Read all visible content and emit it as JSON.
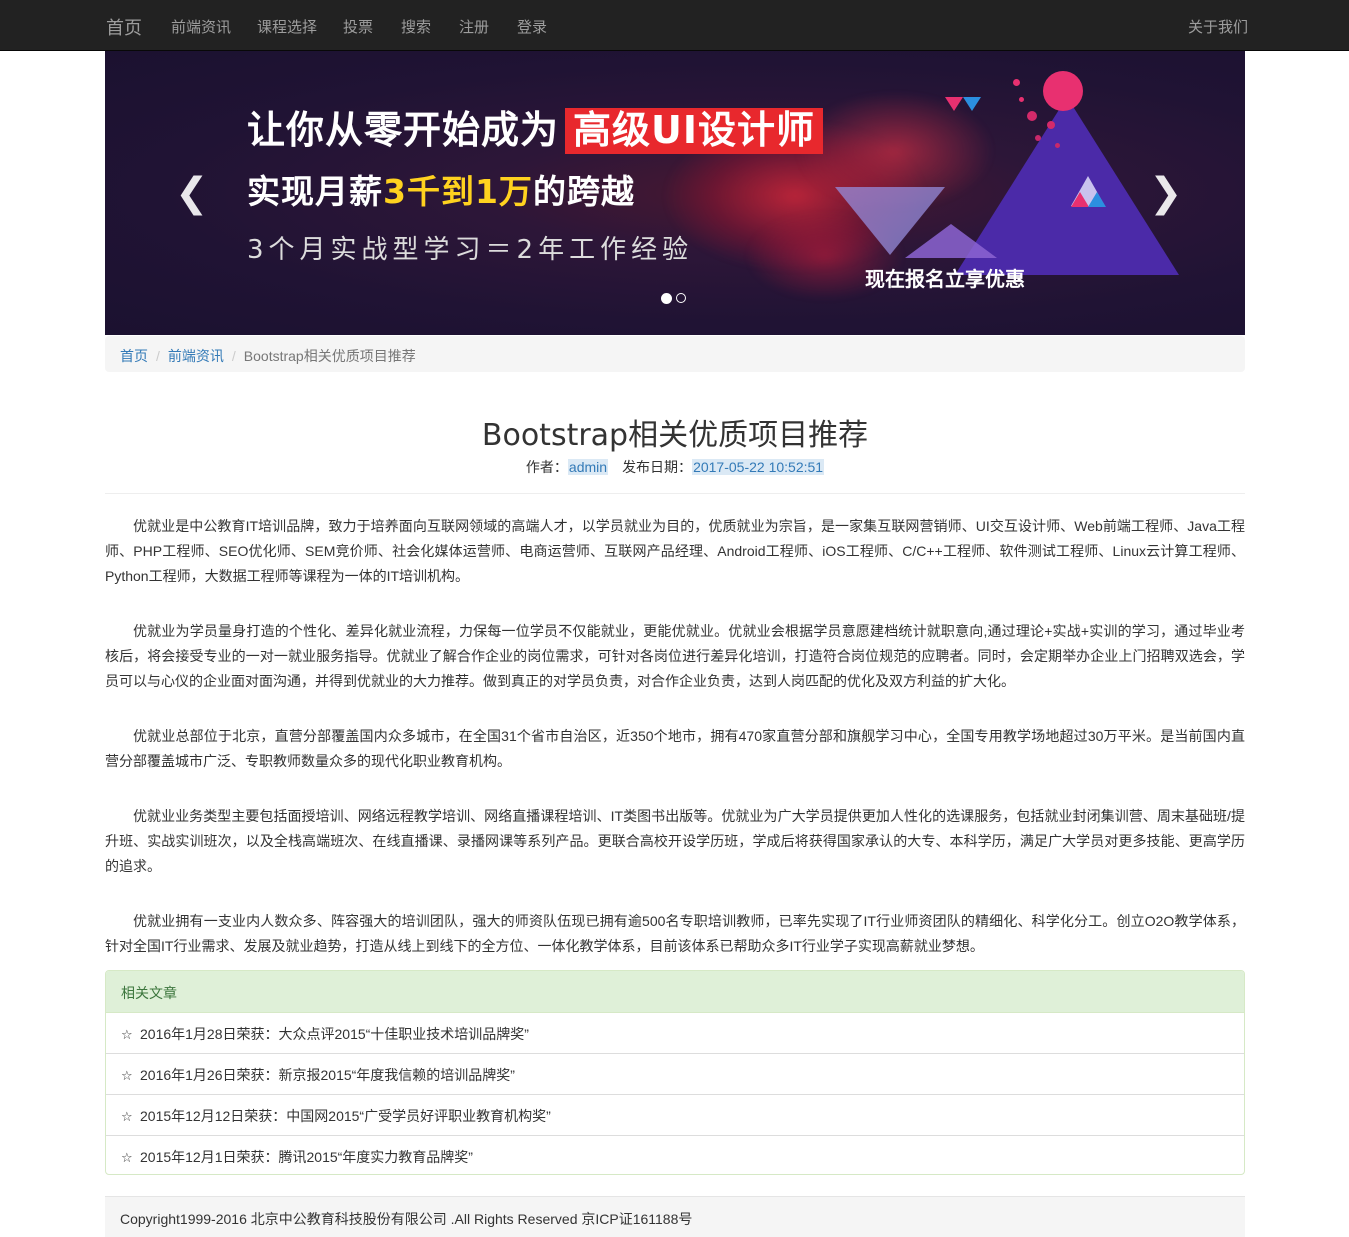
{
  "nav": {
    "brand": "首页",
    "items": [
      "前端资讯",
      "课程选择",
      "投票",
      "搜索",
      "注册",
      "登录"
    ],
    "right": "关于我们"
  },
  "banner": {
    "line1": "让你从零开始成为",
    "line1_highlight": "高级UI设计师",
    "line2_a": "实现月薪",
    "line2_highlight": "3千到1万",
    "line2_b": "的跨越",
    "line3": "3个月实战型学习＝2年工作经验",
    "cta": "现在报名立享优惠",
    "prev_icon": "chevron-left-icon",
    "next_icon": "chevron-right-icon",
    "prev_glyph": "❮",
    "next_glyph": "❯",
    "active_slide": 1,
    "slide_count": 2
  },
  "breadcrumb": {
    "home": "首页",
    "section": "前端资讯",
    "current": "Bootstrap相关优质项目推荐"
  },
  "article": {
    "title": "Bootstrap相关优质项目推荐",
    "author_label": "作者：",
    "author": "admin",
    "date_label": "发布日期：",
    "date": "2017-05-22 10:52:51",
    "paragraphs": [
      "优就业是中公教育IT培训品牌，致力于培养面向互联网领域的高端人才，以学员就业为目的，优质就业为宗旨，是一家集互联网营销师、UI交互设计师、Web前端工程师、Java工程师、PHP工程师、SEO优化师、SEM竞价师、社会化媒体运营师、电商运营师、互联网产品经理、Android工程师、iOS工程师、C/C++工程师、软件测试工程师、Linux云计算工程师、Python工程师，大数据工程师等课程为一体的IT培训机构。",
      "优就业为学员量身打造的个性化、差异化就业流程，力保每一位学员不仅能就业，更能优就业。优就业会根据学员意愿建档统计就职意向,通过理论+实战+实训的学习，通过毕业考核后，将会接受专业的一对一就业服务指导。优就业了解合作企业的岗位需求，可针对各岗位进行差异化培训，打造符合岗位规范的应聘者。同时，会定期举办企业上门招聘双选会，学员可以与心仪的企业面对面沟通，并得到优就业的大力推荐。做到真正的对学员负责，对合作企业负责，达到人岗匹配的优化及双方利益的扩大化。",
      "优就业总部位于北京，直营分部覆盖国内众多城市，在全国31个省市自治区，近350个地市，拥有470家直营分部和旗舰学习中心，全国专用教学场地超过30万平米。是当前国内直营分部覆盖城市广泛、专职教师数量众多的现代化职业教育机构。",
      "优就业业务类型主要包括面授培训、网络远程教学培训、网络直播课程培训、IT类图书出版等。优就业为广大学员提供更加人性化的选课服务，包括就业封闭集训营、周末基础班/提升班、实战实训班次，以及全栈高端班次、在线直播课、录播网课等系列产品。更联合高校开设学历班，学成后将获得国家承认的大专、本科学历，满足广大学员对更多技能、更高学历的追求。",
      "优就业拥有一支业内人数众多、阵容强大的培训团队，强大的师资队伍现已拥有逾500名专职培训教师，已率先实现了IT行业师资团队的精细化、科学化分工。创立O2O教学体系，针对全国IT行业需求、发展及就业趋势，打造从线上到线下的全方位、一体化教学体系，目前该体系已帮助众多IT行业学子实现高薪就业梦想。"
    ]
  },
  "related": {
    "heading": "相关文章",
    "icon": "star-outline-icon",
    "glyph": "☆",
    "items": [
      "2016年1月28日荣获：大众点评2015“十佳职业技术培训品牌奖”",
      "2016年1月26日荣获：新京报2015“年度我信赖的培训品牌奖”",
      "2015年12月12日荣获：中国网2015“广受学员好评职业教育机构奖”",
      "2015年12月1日荣获：腾讯2015“年度实力教育品牌奖”"
    ]
  },
  "footer": {
    "text": "Copyright1999-2016 北京中公教育科技股份有限公司 .All Rights Reserved 京ICP证161188号"
  },
  "colors": {
    "navbar_bg": "#222222",
    "link": "#337ab7",
    "panel_heading_bg": "#dff0d8",
    "banner_highlight": "#e8282d",
    "banner_yellow": "#ffd21f"
  }
}
